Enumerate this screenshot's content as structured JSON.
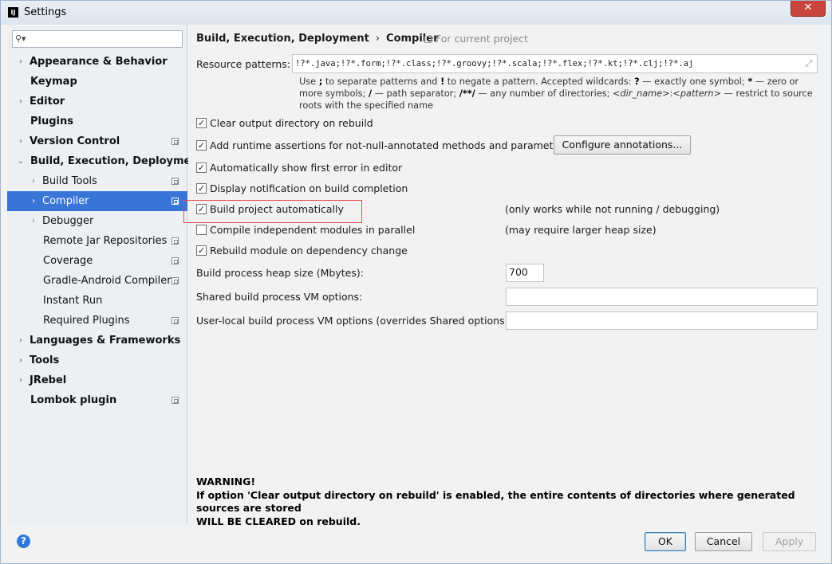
{
  "window": {
    "title": "Settings",
    "close_label": "✕"
  },
  "sidebar": {
    "search": {
      "placeholder": "",
      "value": ""
    },
    "items": [
      {
        "label": "Appearance & Behavior",
        "arrow": "›"
      },
      {
        "label": "Keymap",
        "arrow": ""
      },
      {
        "label": "Editor",
        "arrow": "›"
      },
      {
        "label": "Plugins",
        "arrow": ""
      },
      {
        "label": "Version Control",
        "arrow": "›"
      },
      {
        "label": "Build, Execution, Deployment",
        "arrow": "⌄"
      },
      {
        "label": "Build Tools",
        "arrow": "›"
      },
      {
        "label": "Compiler",
        "arrow": "›"
      },
      {
        "label": "Debugger",
        "arrow": "›"
      },
      {
        "label": "Remote Jar Repositories",
        "arrow": ""
      },
      {
        "label": "Coverage",
        "arrow": ""
      },
      {
        "label": "Gradle-Android Compiler",
        "arrow": ""
      },
      {
        "label": "Instant Run",
        "arrow": ""
      },
      {
        "label": "Required Plugins",
        "arrow": ""
      },
      {
        "label": "Languages & Frameworks",
        "arrow": "›"
      },
      {
        "label": "Tools",
        "arrow": "›"
      },
      {
        "label": "JRebel",
        "arrow": "›"
      },
      {
        "label": "Lombok plugin",
        "arrow": ""
      }
    ]
  },
  "main": {
    "breadcrumb": {
      "parent": "Build, Execution, Deployment",
      "separator": "›",
      "current": "Compiler"
    },
    "for_current_project": "For current project",
    "resource_patterns": {
      "label": "Resource patterns:",
      "value": "!?*.java;!?*.form;!?*.class;!?*.groovy;!?*.scala;!?*.flex;!?*.kt;!?*.clj;!?*.aj"
    },
    "hint": {
      "p1": "Use ",
      "semi": ";",
      "p2": " to separate patterns and ",
      "excl": "!",
      "p3": " to negate a pattern. Accepted wildcards: ",
      "q": "?",
      "p4": " — exactly one symbol; ",
      "star": "*",
      "p5": " — zero or more symbols; ",
      "slash": "/",
      "p6": " — path separator; ",
      "dstar": "/**/",
      "p7": " — any number of directories; ",
      "dirname": "<dir_name>",
      "colon": ":",
      "pattern": "<pattern>",
      "p8": " — restrict to source roots with the specified name"
    },
    "checkboxes": {
      "clear_output": {
        "label": "Clear output directory on rebuild",
        "checked": "✓"
      },
      "runtime_assertions": {
        "label": "Add runtime assertions for not-null-annotated methods and parameters",
        "checked": "✓"
      },
      "show_first_error": {
        "label": "Automatically show first error in editor",
        "checked": "✓"
      },
      "display_notification": {
        "label": "Display notification on build completion",
        "checked": "✓"
      },
      "build_automatically": {
        "label": "Build project automatically",
        "checked": "✓"
      },
      "compile_parallel": {
        "label": "Compile independent modules in parallel",
        "checked": ""
      },
      "rebuild_module": {
        "label": "Rebuild module on dependency change",
        "checked": "✓"
      }
    },
    "configure_annotations": "Configure annotations...",
    "note_build_auto": "(only works while not running / debugging)",
    "note_parallel": "(may require larger heap size)",
    "heap_size": {
      "label": "Build process heap size (Mbytes):",
      "value": "700"
    },
    "shared_vm": {
      "label": "Shared build process VM options:",
      "value": ""
    },
    "user_vm": {
      "label": "User-local build process VM options (overrides Shared options):",
      "value": ""
    },
    "warning": {
      "title": "WARNING!",
      "line1": "If option 'Clear output directory on rebuild' is enabled, the entire contents of directories where generated sources are stored",
      "line2": "WILL BE CLEARED on rebuild."
    }
  },
  "footer": {
    "help": "?",
    "ok": "OK",
    "cancel": "Cancel",
    "apply": "Apply"
  }
}
